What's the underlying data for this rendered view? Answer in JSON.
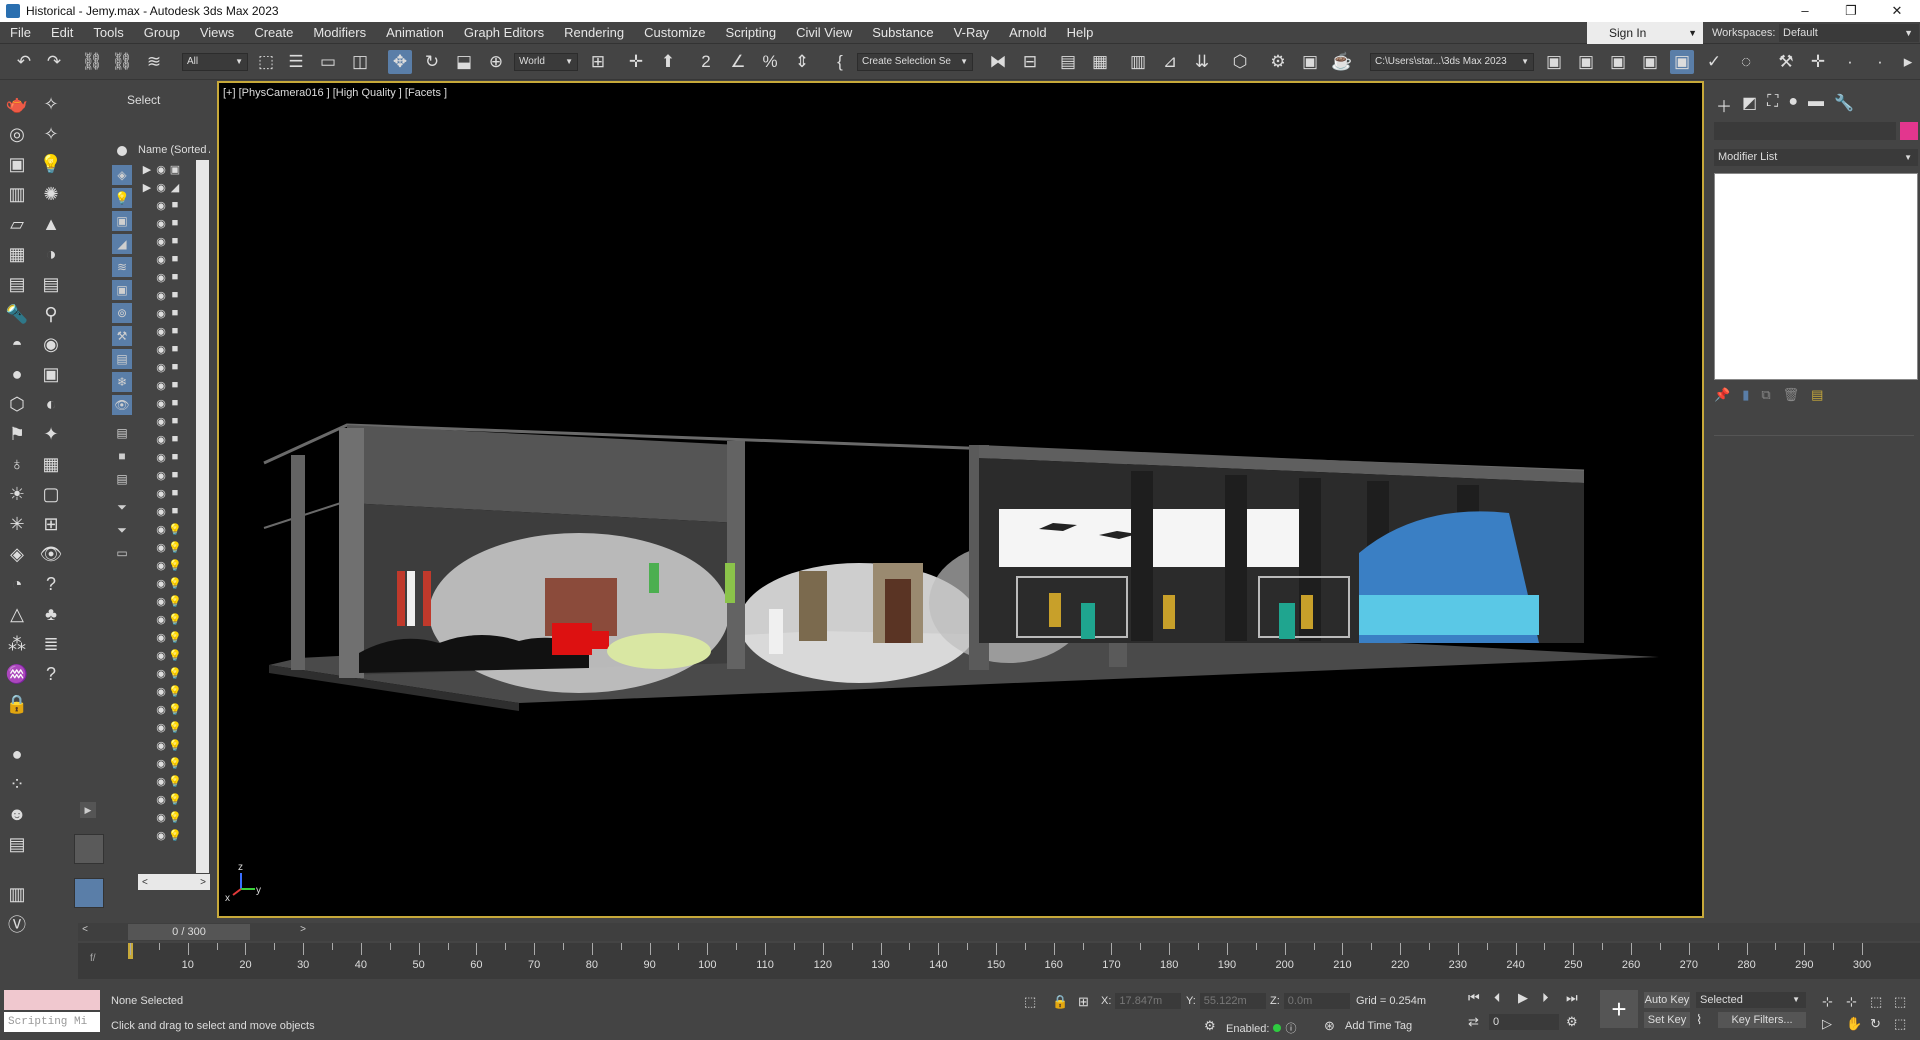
{
  "window": {
    "title": "Historical - Jemy.max - Autodesk 3ds Max 2023",
    "minimize": "–",
    "maximize": "❐",
    "close": "✕"
  },
  "menu": [
    "File",
    "Edit",
    "Tools",
    "Group",
    "Views",
    "Create",
    "Modifiers",
    "Animation",
    "Graph Editors",
    "Rendering",
    "Customize",
    "Scripting",
    "Civil View",
    "Substance",
    "V-Ray",
    "Arnold",
    "Help"
  ],
  "account": {
    "sign_in": "Sign In",
    "workspaces_label": "Workspaces:",
    "workspace": "Default"
  },
  "toolbar": {
    "filter": "All",
    "coord_system": "World",
    "selection_set": "Create Selection Se",
    "project_path": "C:\\Users\\star...\\3ds Max 2023"
  },
  "explorer": {
    "select_label": "Select",
    "name_header": "Name (Sorted Ascending)",
    "left": "<",
    "right": ">",
    "rows": [
      {
        "arrow": "▶",
        "eye": "◉",
        "type": "▣"
      },
      {
        "arrow": "▶",
        "eye": "◉",
        "type": "◢"
      },
      {
        "arrow": "",
        "eye": "◉",
        "type": "■"
      },
      {
        "arrow": "",
        "eye": "◉",
        "type": "■"
      },
      {
        "arrow": "",
        "eye": "◉",
        "type": "■"
      },
      {
        "arrow": "",
        "eye": "◉",
        "type": "■"
      },
      {
        "arrow": "",
        "eye": "◉",
        "type": "■"
      },
      {
        "arrow": "",
        "eye": "◉",
        "type": "■"
      },
      {
        "arrow": "",
        "eye": "◉",
        "type": "■"
      },
      {
        "arrow": "",
        "eye": "◉",
        "type": "■"
      },
      {
        "arrow": "",
        "eye": "◉",
        "type": "■"
      },
      {
        "arrow": "",
        "eye": "◉",
        "type": "■"
      },
      {
        "arrow": "",
        "eye": "◉",
        "type": "■"
      },
      {
        "arrow": "",
        "eye": "◉",
        "type": "■"
      },
      {
        "arrow": "",
        "eye": "◉",
        "type": "■"
      },
      {
        "arrow": "",
        "eye": "◉",
        "type": "■"
      },
      {
        "arrow": "",
        "eye": "◉",
        "type": "■"
      },
      {
        "arrow": "",
        "eye": "◉",
        "type": "■"
      },
      {
        "arrow": "",
        "eye": "◉",
        "type": "■"
      },
      {
        "arrow": "",
        "eye": "◉",
        "type": "■"
      },
      {
        "arrow": "",
        "eye": "◉",
        "type": "💡"
      },
      {
        "arrow": "",
        "eye": "◉",
        "type": "💡"
      },
      {
        "arrow": "",
        "eye": "◉",
        "type": "💡"
      },
      {
        "arrow": "",
        "eye": "◉",
        "type": "💡"
      },
      {
        "arrow": "",
        "eye": "◉",
        "type": "💡"
      },
      {
        "arrow": "",
        "eye": "◉",
        "type": "💡"
      },
      {
        "arrow": "",
        "eye": "◉",
        "type": "💡"
      },
      {
        "arrow": "",
        "eye": "◉",
        "type": "💡"
      },
      {
        "arrow": "",
        "eye": "◉",
        "type": "💡"
      },
      {
        "arrow": "",
        "eye": "◉",
        "type": "💡"
      },
      {
        "arrow": "",
        "eye": "◉",
        "type": "💡"
      },
      {
        "arrow": "",
        "eye": "◉",
        "type": "💡"
      },
      {
        "arrow": "",
        "eye": "◉",
        "type": "💡"
      },
      {
        "arrow": "",
        "eye": "◉",
        "type": "💡"
      },
      {
        "arrow": "",
        "eye": "◉",
        "type": "💡"
      },
      {
        "arrow": "",
        "eye": "◉",
        "type": "💡"
      },
      {
        "arrow": "",
        "eye": "◉",
        "type": "💡"
      },
      {
        "arrow": "",
        "eye": "◉",
        "type": "💡"
      }
    ]
  },
  "viewport": {
    "label": "[+] [PhysCamera016 ] [High Quality ] [Facets ]",
    "axis_x": "x",
    "axis_y": "y",
    "axis_z": "z"
  },
  "command_panel": {
    "modifier_list": "Modifier List",
    "object_color": "#e3368e"
  },
  "time": {
    "current": "0 / 300",
    "prev": "<",
    "next": ">",
    "ticks": [
      10,
      20,
      30,
      40,
      50,
      60,
      70,
      80,
      90,
      100,
      110,
      120,
      130,
      140,
      150,
      160,
      170,
      180,
      190,
      200,
      210,
      220,
      230,
      240,
      250,
      260,
      270,
      280,
      290,
      300
    ]
  },
  "status": {
    "selection": "None Selected",
    "prompt": "Click and drag to select and move objects",
    "script_placeholder": "Scripting Mi",
    "x_label": "X:",
    "x_value": "17.847m",
    "y_label": "Y:",
    "y_value": "55.122m",
    "z_label": "Z:",
    "z_value": "0.0m",
    "grid": "Grid = 0.254m",
    "enabled": "Enabled:",
    "add_time_tag": "Add Time Tag",
    "frame": "0",
    "auto_key": "Auto Key",
    "set_key": "Set Key",
    "key_mode": "Selected",
    "key_filters": "Key Filters..."
  }
}
